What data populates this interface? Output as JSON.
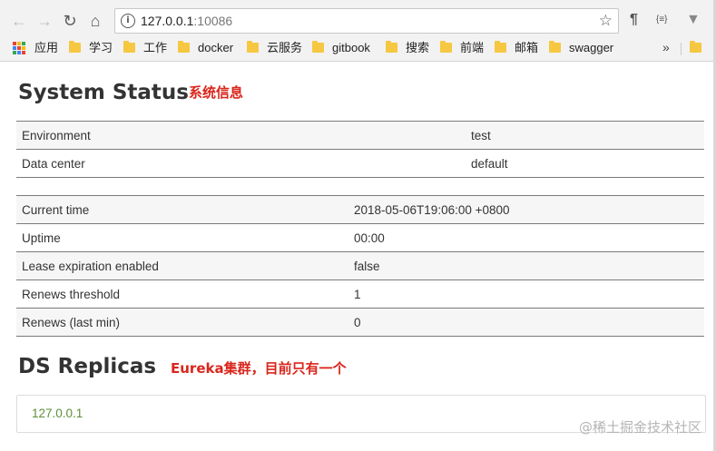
{
  "browser": {
    "url_host": "127.0.0.1",
    "url_port": ":10086",
    "icons": {
      "back": "back-arrow-icon",
      "forward": "forward-arrow-icon",
      "reload": "reload-icon",
      "home": "home-icon",
      "star": "bookmark-star-icon",
      "ext1": "pilcrow-extension-icon",
      "ext2": "json-extension-icon",
      "ext3": "vue-extension-icon"
    },
    "glyphs": {
      "back": "←",
      "forward": "→",
      "reload": "↻",
      "home": "⌂",
      "info": "i",
      "star": "☆",
      "ext1": "¶",
      "ext2": "{≡}",
      "ext3": "▼",
      "more": "»"
    }
  },
  "bookmarks": {
    "apps_label": "应用",
    "items": [
      {
        "label": "学习"
      },
      {
        "label": "工作"
      },
      {
        "label": "docker"
      },
      {
        "label": "云服务"
      },
      {
        "label": "gitbook"
      },
      {
        "label": "搜索"
      },
      {
        "label": "前端"
      },
      {
        "label": "邮箱"
      },
      {
        "label": "swagger"
      }
    ],
    "apps_colors": [
      "#e94235",
      "#fbbc04",
      "#34a853",
      "#4285f4",
      "#e94235",
      "#fbbc04",
      "#34a853",
      "#4285f4",
      "#e94235"
    ],
    "folder_color": "#f6c842"
  },
  "system_status": {
    "title": "System Status",
    "annotation": "系统信息",
    "env_rows": [
      {
        "label": "Environment",
        "value": "test"
      },
      {
        "label": "Data center",
        "value": "default"
      }
    ],
    "stat_rows": [
      {
        "label": "Current time",
        "value": "2018-05-06T19:06:00 +0800"
      },
      {
        "label": "Uptime",
        "value": "00:00"
      },
      {
        "label": "Lease expiration enabled",
        "value": "false"
      },
      {
        "label": "Renews threshold",
        "value": "1"
      },
      {
        "label": "Renews (last min)",
        "value": "0"
      }
    ]
  },
  "ds_replicas": {
    "title": "DS Replicas",
    "annotation": "Eureka集群，目前只有一个",
    "replicas": [
      {
        "address": "127.0.0.1"
      }
    ]
  },
  "watermark": "@稀土掘金技术社区",
  "colors": {
    "annotation": "#d9261c",
    "replica_link": "#5d8f3b"
  }
}
